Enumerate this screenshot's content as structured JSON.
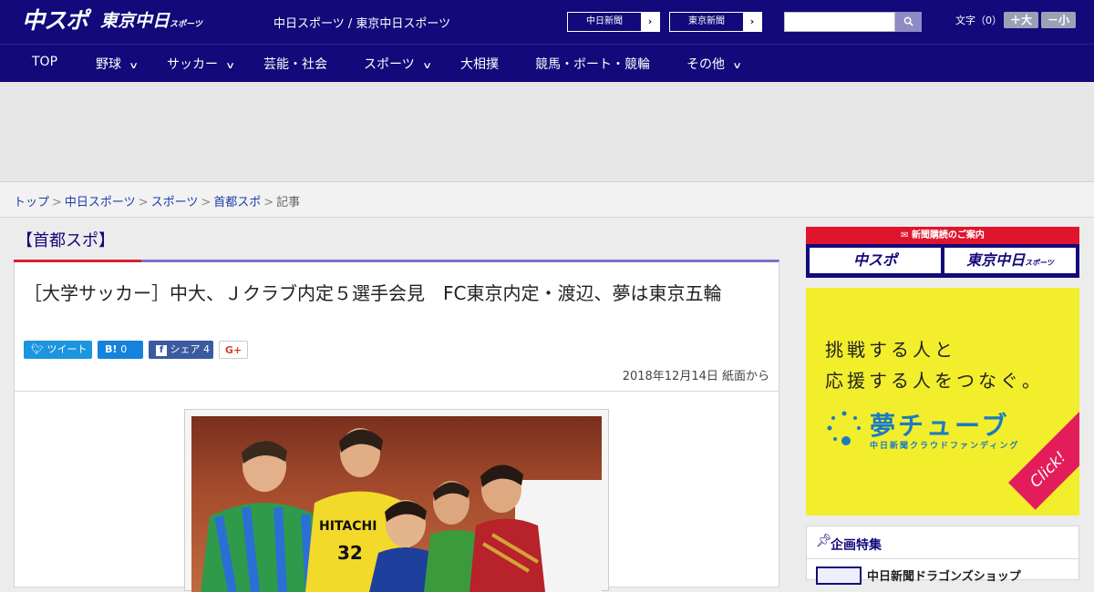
{
  "header": {
    "logo_main": "中スポ",
    "logo_tokyo": "東京中日",
    "logo_tokyo_small": "スポーツ",
    "site_title": "中日スポーツ / 東京中日スポーツ",
    "links": [
      {
        "label": "中日新聞"
      },
      {
        "label": "東京新聞"
      }
    ],
    "search": {
      "value": "",
      "placeholder": ""
    },
    "font_size": {
      "label": "文字（0）",
      "increase": "＋大",
      "decrease": "－小"
    }
  },
  "nav": {
    "items": [
      {
        "label": "TOP",
        "dropdown": false
      },
      {
        "label": "野球",
        "dropdown": true
      },
      {
        "label": "サッカー",
        "dropdown": true
      },
      {
        "label": "芸能・社会",
        "dropdown": false
      },
      {
        "label": "スポーツ",
        "dropdown": true
      },
      {
        "label": "大相撲",
        "dropdown": false
      },
      {
        "label": "競馬・ボート・競輪",
        "dropdown": false
      },
      {
        "label": "その他",
        "dropdown": true
      }
    ]
  },
  "breadcrumb": {
    "items": [
      "トップ",
      "中日スポーツ",
      "スポーツ",
      "首都スポ"
    ],
    "current": "記事",
    "separator": ">"
  },
  "section_label": "【首都スポ】",
  "article": {
    "title": "［大学サッカー］中大、Ｊクラブ内定５選手会見　FC東京内定・渡辺、夢は東京五輪",
    "share": {
      "tweet": "ツイート",
      "hatena": "B!",
      "hatena_count": "0",
      "facebook": "シェア",
      "facebook_count": "4",
      "gplus": "G+"
    },
    "date": "2018年12月14日 紙面から"
  },
  "sidebar": {
    "subscribe_banner": {
      "heading": "新聞購読のご案内",
      "left": "中スポ",
      "right": "東京中日",
      "right_small": "スポーツ"
    },
    "ad": {
      "line1": "挑戦する人と",
      "line2": "応援する人をつなぐ。",
      "brand": "夢チューブ",
      "brand_sub": "中日新聞クラウドファンディング",
      "click": "Click!"
    },
    "feature": {
      "title": "企画特集",
      "first_item": "中日新聞ドラゴンズショップ"
    }
  },
  "colors": {
    "header_bg": "#13097a",
    "accent_red": "#d8202f",
    "ad_yellow": "#f2ee2b",
    "ad_blue": "#1a7ac4"
  }
}
